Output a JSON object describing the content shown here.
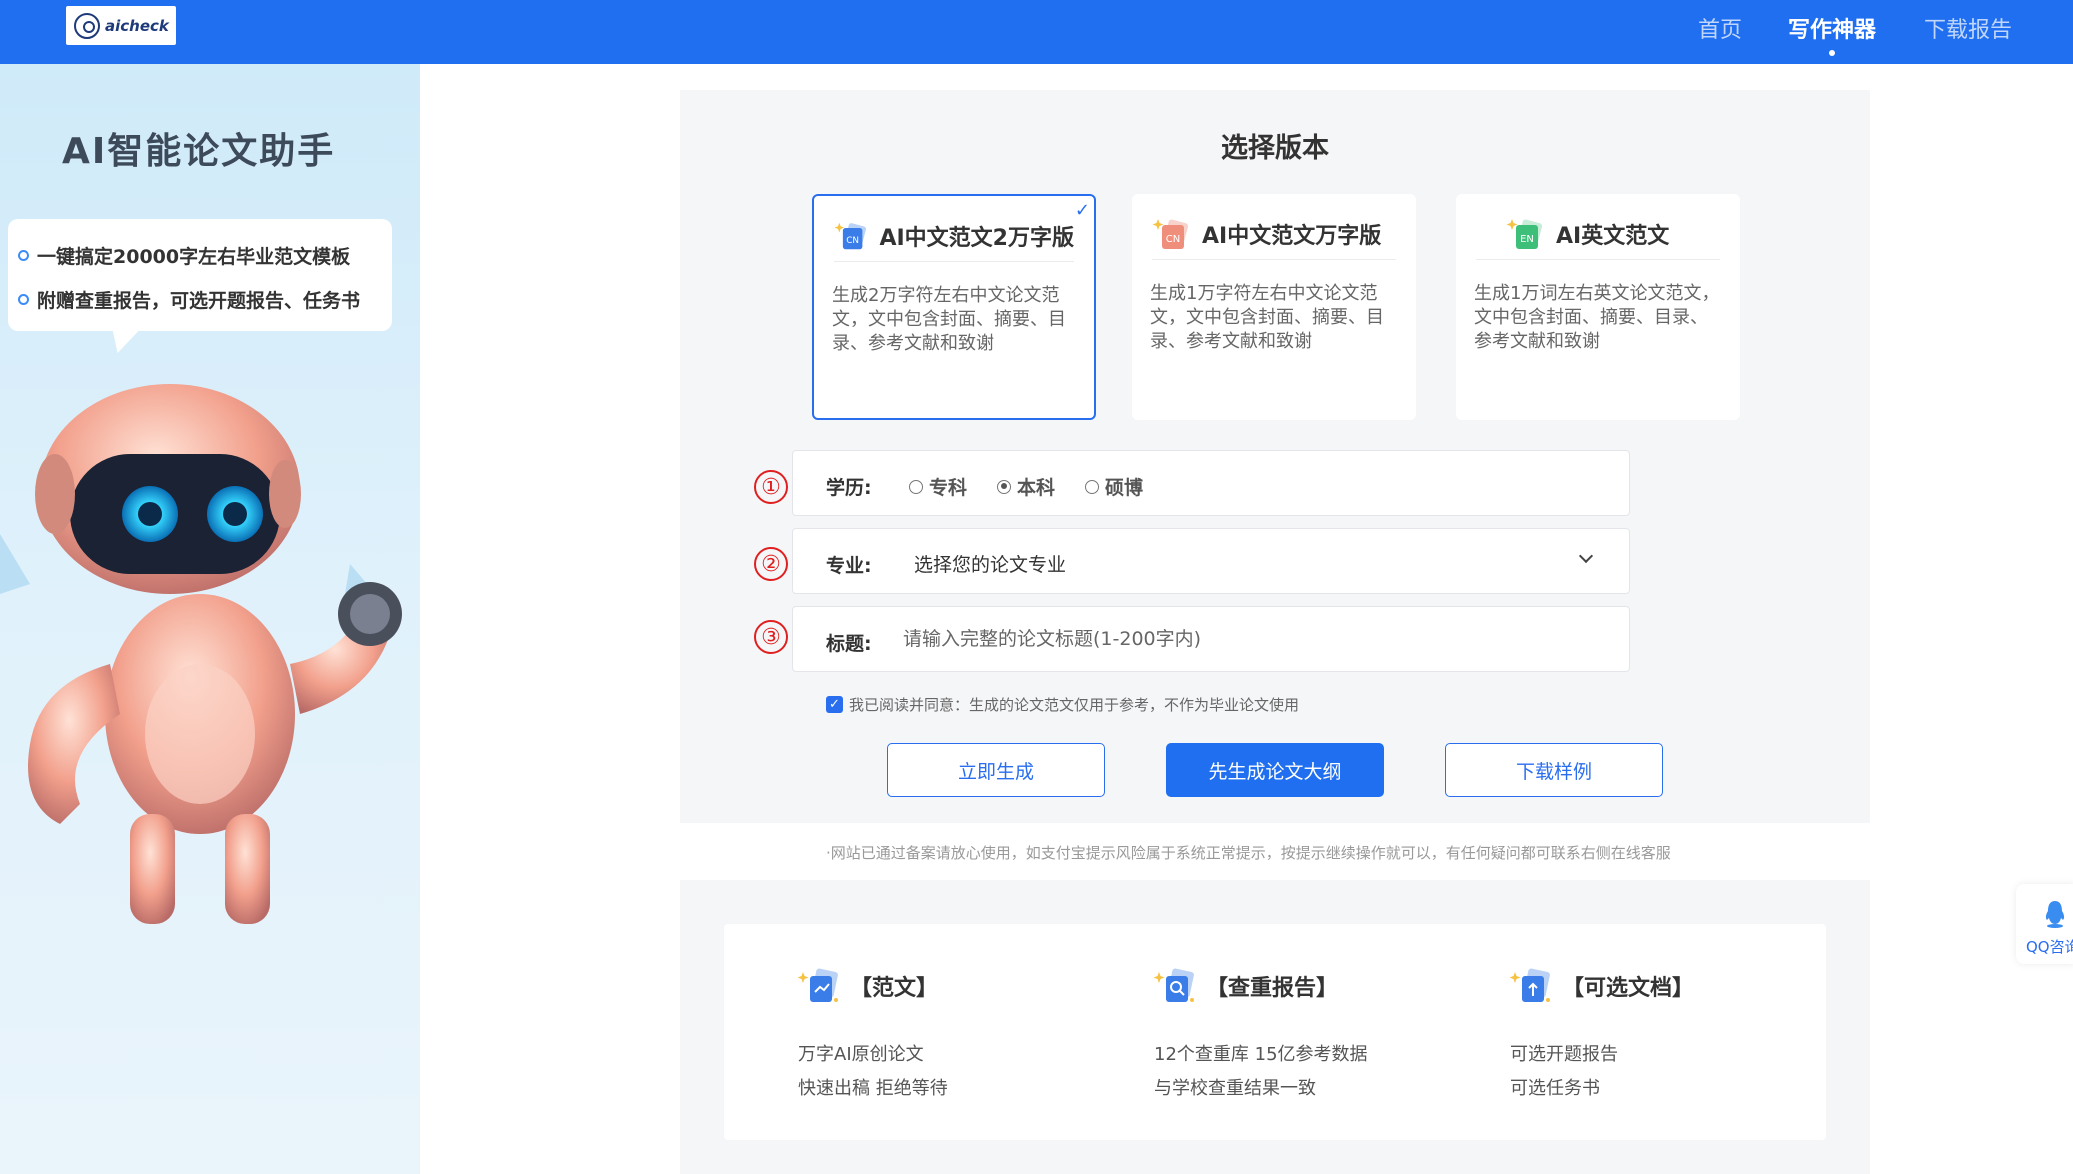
{
  "header": {
    "logo_text": "aicheck",
    "nav": [
      {
        "label": "首页",
        "active": false
      },
      {
        "label": "写作神器",
        "active": true
      },
      {
        "label": "下载报告",
        "active": false
      }
    ]
  },
  "left": {
    "title": "AI智能论文助手",
    "bullets": [
      "一键搞定20000字左右毕业范文模板",
      "附赠查重报告，可选开题报告、任务书"
    ]
  },
  "main": {
    "section_title": "选择版本",
    "versions": [
      {
        "icon": "cn-badge-icon",
        "icon_label": "CN",
        "name": "AI中文范文2万字版",
        "desc": "生成2万字符左右中文论文范文，文中包含封面、摘要、目录、参考文献和致谢",
        "selected": true
      },
      {
        "icon": "cn-badge-icon",
        "icon_label": "CN",
        "name": "AI中文范文万字版",
        "desc": "生成1万字符左右中文论文范文，文中包含封面、摘要、目录、参考文献和致谢",
        "selected": false
      },
      {
        "icon": "en-badge-icon",
        "icon_label": "EN",
        "name": "AI英文范文",
        "desc": "生成1万词左右英文论文范文，文中包含封面、摘要、目录、参考文献和致谢",
        "selected": false
      }
    ],
    "form": {
      "steps": [
        "①",
        "②",
        "③"
      ],
      "education_label": "学历:",
      "education_options": [
        {
          "label": "专科",
          "checked": false
        },
        {
          "label": "本科",
          "checked": true
        },
        {
          "label": "硕博",
          "checked": false
        }
      ],
      "major_label": "专业:",
      "major_value": "选择您的论文专业",
      "title_label": "标题:",
      "title_placeholder": "请输入完整的论文标题(1-200字内)"
    },
    "agreement": {
      "checked": true,
      "text": "我已阅读并同意：生成的论文范文仅用于参考，不作为毕业论文使用"
    },
    "buttons": {
      "generate": "立即生成",
      "outline": "先生成论文大纲",
      "sample": "下载样例"
    },
    "notice": "·网站已通过备案请放心使用，如支付宝提示风险属于系统正常提示，按提示继续操作就可以，有任何疑问都可联系右侧在线客服"
  },
  "features": [
    {
      "icon": "document-icon",
      "title": "【范文】",
      "lines": [
        "万字AI原创论文",
        "快速出稿 拒绝等待"
      ]
    },
    {
      "icon": "magnifier-icon",
      "title": "【查重报告】",
      "lines": [
        "12个查重库 15亿参考数据",
        "与学校查重结果一致"
      ]
    },
    {
      "icon": "upload-doc-icon",
      "title": "【可选文档】",
      "lines": [
        "可选开题报告",
        "可选任务书"
      ]
    }
  ],
  "qq": {
    "label": "QQ咨询"
  },
  "colors": {
    "primary": "#1f6ff0",
    "step": "#e02020"
  }
}
